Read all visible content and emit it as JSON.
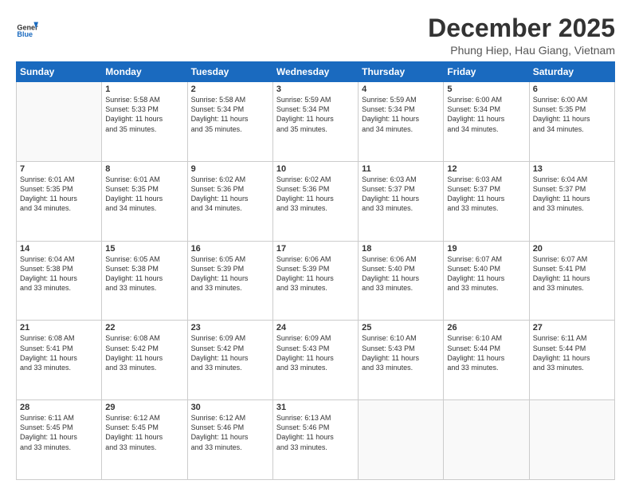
{
  "header": {
    "logo": {
      "line1": "General",
      "line2": "Blue"
    },
    "title": "December 2025",
    "subtitle": "Phung Hiep, Hau Giang, Vietnam"
  },
  "weekdays": [
    "Sunday",
    "Monday",
    "Tuesday",
    "Wednesday",
    "Thursday",
    "Friday",
    "Saturday"
  ],
  "weeks": [
    [
      {
        "day": "",
        "text": ""
      },
      {
        "day": "1",
        "text": "Sunrise: 5:58 AM\nSunset: 5:33 PM\nDaylight: 11 hours\nand 35 minutes."
      },
      {
        "day": "2",
        "text": "Sunrise: 5:58 AM\nSunset: 5:34 PM\nDaylight: 11 hours\nand 35 minutes."
      },
      {
        "day": "3",
        "text": "Sunrise: 5:59 AM\nSunset: 5:34 PM\nDaylight: 11 hours\nand 35 minutes."
      },
      {
        "day": "4",
        "text": "Sunrise: 5:59 AM\nSunset: 5:34 PM\nDaylight: 11 hours\nand 34 minutes."
      },
      {
        "day": "5",
        "text": "Sunrise: 6:00 AM\nSunset: 5:34 PM\nDaylight: 11 hours\nand 34 minutes."
      },
      {
        "day": "6",
        "text": "Sunrise: 6:00 AM\nSunset: 5:35 PM\nDaylight: 11 hours\nand 34 minutes."
      }
    ],
    [
      {
        "day": "7",
        "text": "Sunrise: 6:01 AM\nSunset: 5:35 PM\nDaylight: 11 hours\nand 34 minutes."
      },
      {
        "day": "8",
        "text": "Sunrise: 6:01 AM\nSunset: 5:35 PM\nDaylight: 11 hours\nand 34 minutes."
      },
      {
        "day": "9",
        "text": "Sunrise: 6:02 AM\nSunset: 5:36 PM\nDaylight: 11 hours\nand 34 minutes."
      },
      {
        "day": "10",
        "text": "Sunrise: 6:02 AM\nSunset: 5:36 PM\nDaylight: 11 hours\nand 33 minutes."
      },
      {
        "day": "11",
        "text": "Sunrise: 6:03 AM\nSunset: 5:37 PM\nDaylight: 11 hours\nand 33 minutes."
      },
      {
        "day": "12",
        "text": "Sunrise: 6:03 AM\nSunset: 5:37 PM\nDaylight: 11 hours\nand 33 minutes."
      },
      {
        "day": "13",
        "text": "Sunrise: 6:04 AM\nSunset: 5:37 PM\nDaylight: 11 hours\nand 33 minutes."
      }
    ],
    [
      {
        "day": "14",
        "text": "Sunrise: 6:04 AM\nSunset: 5:38 PM\nDaylight: 11 hours\nand 33 minutes."
      },
      {
        "day": "15",
        "text": "Sunrise: 6:05 AM\nSunset: 5:38 PM\nDaylight: 11 hours\nand 33 minutes."
      },
      {
        "day": "16",
        "text": "Sunrise: 6:05 AM\nSunset: 5:39 PM\nDaylight: 11 hours\nand 33 minutes."
      },
      {
        "day": "17",
        "text": "Sunrise: 6:06 AM\nSunset: 5:39 PM\nDaylight: 11 hours\nand 33 minutes."
      },
      {
        "day": "18",
        "text": "Sunrise: 6:06 AM\nSunset: 5:40 PM\nDaylight: 11 hours\nand 33 minutes."
      },
      {
        "day": "19",
        "text": "Sunrise: 6:07 AM\nSunset: 5:40 PM\nDaylight: 11 hours\nand 33 minutes."
      },
      {
        "day": "20",
        "text": "Sunrise: 6:07 AM\nSunset: 5:41 PM\nDaylight: 11 hours\nand 33 minutes."
      }
    ],
    [
      {
        "day": "21",
        "text": "Sunrise: 6:08 AM\nSunset: 5:41 PM\nDaylight: 11 hours\nand 33 minutes."
      },
      {
        "day": "22",
        "text": "Sunrise: 6:08 AM\nSunset: 5:42 PM\nDaylight: 11 hours\nand 33 minutes."
      },
      {
        "day": "23",
        "text": "Sunrise: 6:09 AM\nSunset: 5:42 PM\nDaylight: 11 hours\nand 33 minutes."
      },
      {
        "day": "24",
        "text": "Sunrise: 6:09 AM\nSunset: 5:43 PM\nDaylight: 11 hours\nand 33 minutes."
      },
      {
        "day": "25",
        "text": "Sunrise: 6:10 AM\nSunset: 5:43 PM\nDaylight: 11 hours\nand 33 minutes."
      },
      {
        "day": "26",
        "text": "Sunrise: 6:10 AM\nSunset: 5:44 PM\nDaylight: 11 hours\nand 33 minutes."
      },
      {
        "day": "27",
        "text": "Sunrise: 6:11 AM\nSunset: 5:44 PM\nDaylight: 11 hours\nand 33 minutes."
      }
    ],
    [
      {
        "day": "28",
        "text": "Sunrise: 6:11 AM\nSunset: 5:45 PM\nDaylight: 11 hours\nand 33 minutes."
      },
      {
        "day": "29",
        "text": "Sunrise: 6:12 AM\nSunset: 5:45 PM\nDaylight: 11 hours\nand 33 minutes."
      },
      {
        "day": "30",
        "text": "Sunrise: 6:12 AM\nSunset: 5:46 PM\nDaylight: 11 hours\nand 33 minutes."
      },
      {
        "day": "31",
        "text": "Sunrise: 6:13 AM\nSunset: 5:46 PM\nDaylight: 11 hours\nand 33 minutes."
      },
      {
        "day": "",
        "text": ""
      },
      {
        "day": "",
        "text": ""
      },
      {
        "day": "",
        "text": ""
      }
    ]
  ]
}
